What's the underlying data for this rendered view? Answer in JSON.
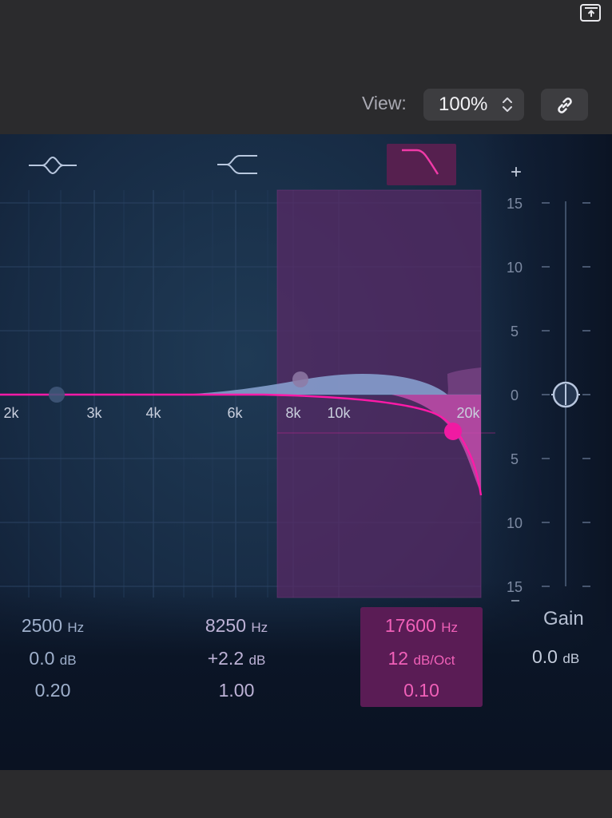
{
  "toolbar": {
    "view_label": "View:",
    "zoom_value": "100%",
    "icons": [
      "window-toggle-icon",
      "chevron-updown-icon",
      "link-icon"
    ]
  },
  "band_types": [
    {
      "icon": "bell-icon",
      "selected": false
    },
    {
      "icon": "low-shelf-icon",
      "selected": false
    },
    {
      "icon": "high-cut-icon",
      "selected": true
    }
  ],
  "plus_label": "+",
  "freq_ticks": [
    "2k",
    "3k",
    "4k",
    "6k",
    "8k",
    "10k",
    "20k"
  ],
  "db_ticks": [
    "15",
    "10",
    "5",
    "0",
    "5",
    "10",
    "15"
  ],
  "bands": [
    {
      "freq": "2500",
      "freq_unit": "Hz",
      "gain": "0.0",
      "gain_unit": "dB",
      "q": "0.20"
    },
    {
      "freq": "8250",
      "freq_unit": "Hz",
      "gain": "+2.2",
      "gain_unit": "dB",
      "q": "1.00"
    },
    {
      "freq": "17600",
      "freq_unit": "Hz",
      "gain": "12",
      "gain_unit": "dB/Oct",
      "q": "0.10"
    }
  ],
  "gain": {
    "label": "Gain",
    "value": "0.0",
    "unit": "dB"
  },
  "colors": {
    "accent": "#e8199a",
    "selected_bg": "#56204f",
    "curve_blue": "#7b97c9"
  }
}
